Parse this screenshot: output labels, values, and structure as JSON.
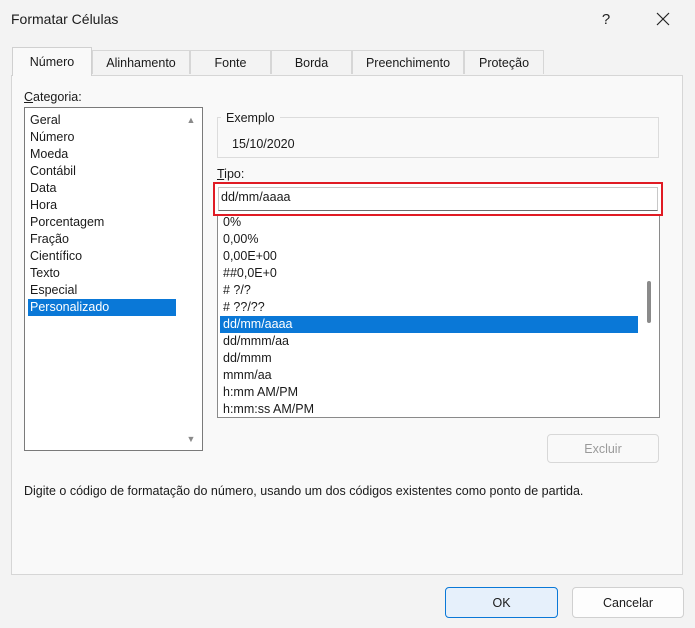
{
  "window": {
    "title": "Formatar Células",
    "help_glyph": "?",
    "close_glyph": "✕"
  },
  "tabs": [
    {
      "label": "Número",
      "active": true
    },
    {
      "label": "Alinhamento"
    },
    {
      "label": "Fonte"
    },
    {
      "label": "Borda"
    },
    {
      "label": "Preenchimento"
    },
    {
      "label": "Proteção"
    }
  ],
  "category": {
    "label_first": "C",
    "label_rest": "ategoria:",
    "items": [
      "Geral",
      "Número",
      "Moeda",
      "Contábil",
      "Data",
      "Hora",
      "Porcentagem",
      "Fração",
      "Científico",
      "Texto",
      "Especial",
      "Personalizado"
    ],
    "selected": "Personalizado"
  },
  "example": {
    "label": "Exemplo",
    "value": "15/10/2020"
  },
  "tipo": {
    "label_first": "T",
    "label_rest": "ipo:",
    "value": "dd/mm/aaaa",
    "formats": [
      "0%",
      "0,00%",
      "0,00E+00",
      "##0,0E+0",
      "# ?/?",
      "# ??/??",
      "dd/mm/aaaa",
      "dd/mmm/aa",
      "dd/mmm",
      "mmm/aa",
      "h:mm AM/PM",
      "h:mm:ss AM/PM"
    ],
    "selected": "dd/mm/aaaa"
  },
  "buttons": {
    "delete": "Excluir",
    "ok": "OK",
    "cancel": "Cancelar"
  },
  "hint": "Digite o código de formatação do número, usando um dos códigos existentes como ponto de partida.",
  "colors": {
    "accent": "#0a78d7",
    "highlight_border": "#e01b24"
  }
}
